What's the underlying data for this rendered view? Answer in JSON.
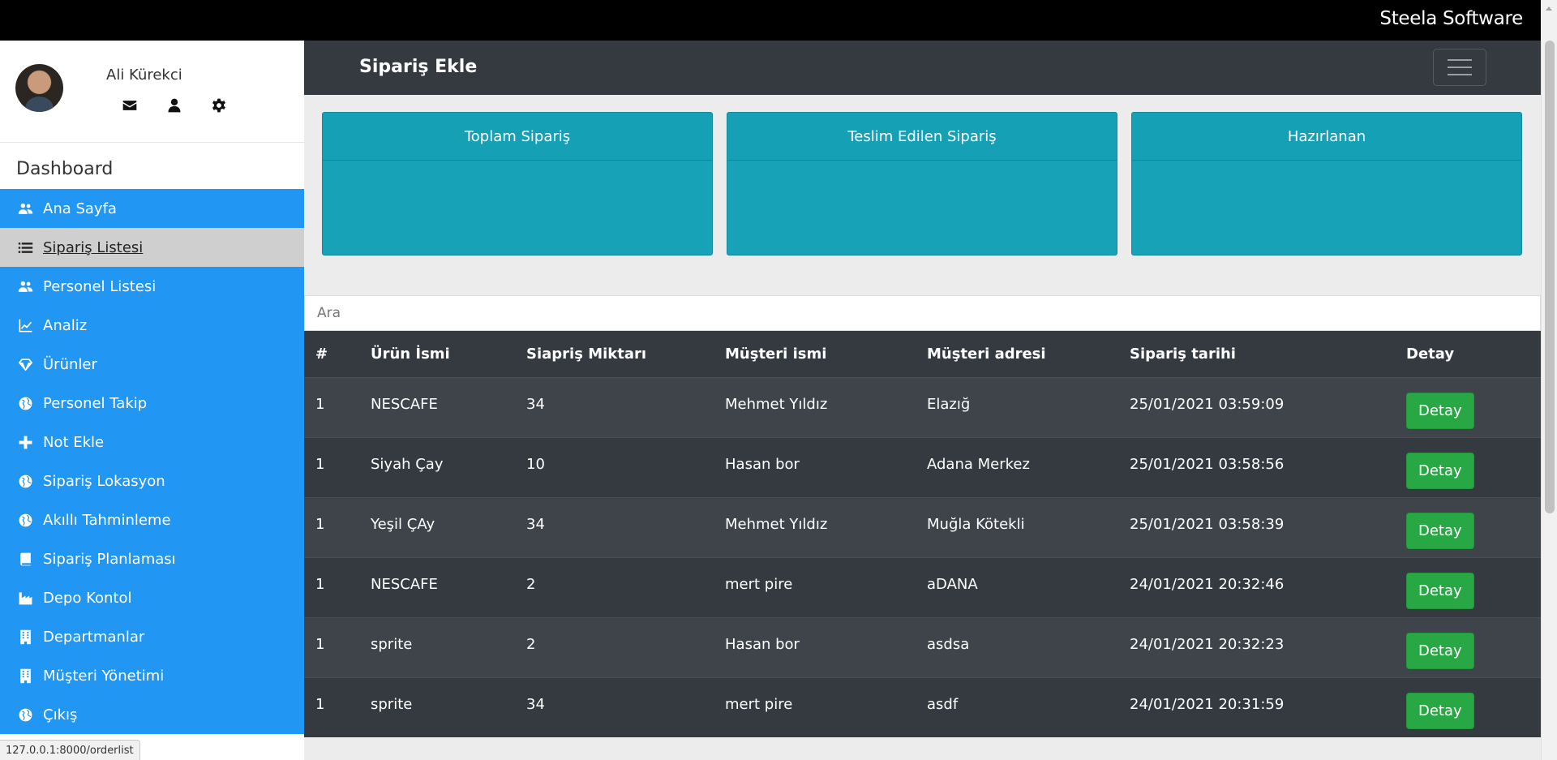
{
  "topbar": {
    "brand": "Steela Software"
  },
  "profile": {
    "name": "Ali Kürekci"
  },
  "sidebar": {
    "heading": "Dashboard",
    "items": [
      {
        "label": "Ana Sayfa",
        "icon": "users-icon"
      },
      {
        "label": " Sipariş Listesi",
        "icon": "list-icon",
        "active": true
      },
      {
        "label": "Personel Listesi",
        "icon": "users-icon"
      },
      {
        "label": "Analiz",
        "icon": "line-chart-icon"
      },
      {
        "label": "Ürünler",
        "icon": "diamond-icon"
      },
      {
        "label": "Personel Takip",
        "icon": "globe-icon"
      },
      {
        "label": "Not Ekle",
        "icon": "plus-icon"
      },
      {
        "label": "Sipariş Lokasyon",
        "icon": "globe-icon"
      },
      {
        "label": "Akıllı Tahminleme",
        "icon": "globe-icon"
      },
      {
        "label": "Sipariş Planlaması",
        "icon": "book-icon"
      },
      {
        "label": "Depo Kontol",
        "icon": "industry-icon"
      },
      {
        "label": "Departmanlar",
        "icon": "building-icon"
      },
      {
        "label": "Müşteri Yönetimi",
        "icon": "building-icon"
      },
      {
        "label": "Çıkış",
        "icon": "globe-icon"
      }
    ]
  },
  "header": {
    "title": "Sipariş Ekle"
  },
  "cards": [
    {
      "title": "Toplam Sipariş"
    },
    {
      "title": "Teslim Edilen Sipariş"
    },
    {
      "title": "Hazırlanan"
    }
  ],
  "search": {
    "placeholder": "Ara"
  },
  "table": {
    "columns": [
      "#",
      "Ürün İsmi",
      "Siapriş Miktarı",
      "Müşteri ismi",
      "Müşteri adresi",
      "Sipariş tarihi",
      "Detay"
    ],
    "button_label": "Detay",
    "rows": [
      [
        "1",
        "NESCAFE",
        "34",
        "Mehmet Yıldız",
        "Elazığ",
        "25/01/2021 03:59:09"
      ],
      [
        "1",
        "Siyah Çay",
        "10",
        "Hasan bor",
        "Adana Merkez",
        "25/01/2021 03:58:56"
      ],
      [
        "1",
        "Yeşil ÇAy",
        "34",
        "Mehmet Yıldız",
        "Muğla Kötekli",
        "25/01/2021 03:58:39"
      ],
      [
        "1",
        "NESCAFE",
        "2",
        "mert pire",
        "aDANA",
        "24/01/2021 20:32:46"
      ],
      [
        "1",
        "sprite",
        "2",
        "Hasan bor",
        "asdsa",
        "24/01/2021 20:32:23"
      ],
      [
        "1",
        "sprite",
        "34",
        "mert pire",
        "asdf",
        "24/01/2021 20:31:59"
      ]
    ]
  },
  "statusbar": {
    "url": "127.0.0.1:8000/orderlist"
  }
}
